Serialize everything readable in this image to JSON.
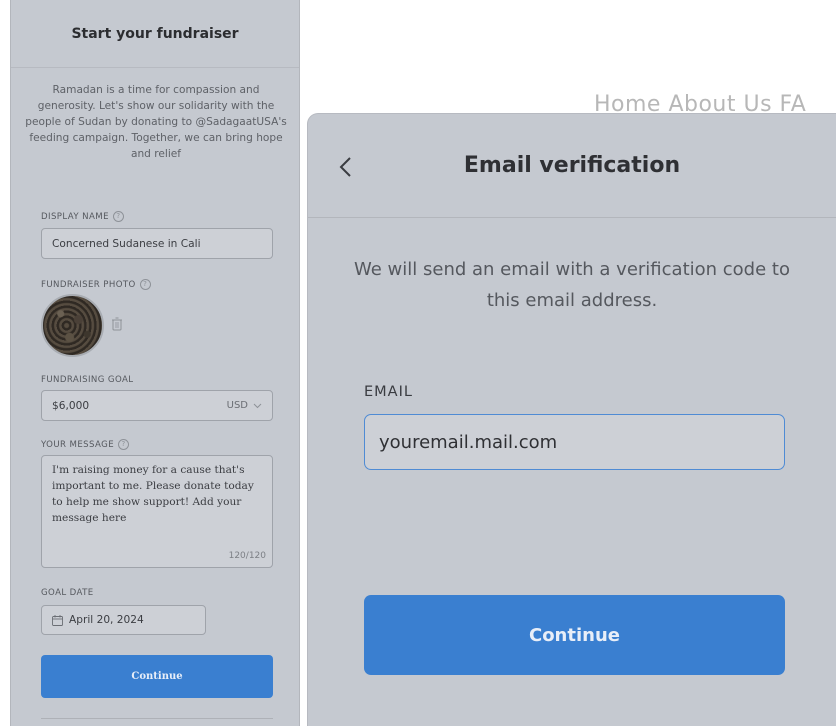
{
  "fundraiser_form": {
    "title": "Start your fundraiser",
    "intro": "Ramadan is a time for compassion and generosity. Let's show our solidarity with the people of Sudan by donating to @SadagaatUSA's feeding campaign. Together, we can bring hope and relief",
    "display_name_label": "DISPLAY NAME",
    "display_name_value": "Concerned Sudanese in Cali",
    "photo_label": "FUNDRAISER PHOTO",
    "goal_label": "FUNDRAISING GOAL",
    "goal_value": "$6,000",
    "currency": "USD",
    "message_label": "YOUR MESSAGE",
    "message_value": "I'm raising money for a cause that's important to me. Please donate today to help me show support! Add your message here",
    "message_count": "120/120",
    "goal_date_label": "GOAL DATE",
    "goal_date_value": "April 20, 2024",
    "continue_label": "Continue",
    "help_symbol": "?"
  },
  "email_verification": {
    "title": "Email verification",
    "description": "We will send an email with a verification code to this email address.",
    "email_label": "EMAIL",
    "email_value": "youremail.mail.com",
    "continue_label": "Continue"
  },
  "background_nav": {
    "text": "Home About Us FA"
  },
  "colors": {
    "accent": "#3a7fd0",
    "panel_bg": "#c5c9d0",
    "input_focus": "#4f8bd4"
  }
}
